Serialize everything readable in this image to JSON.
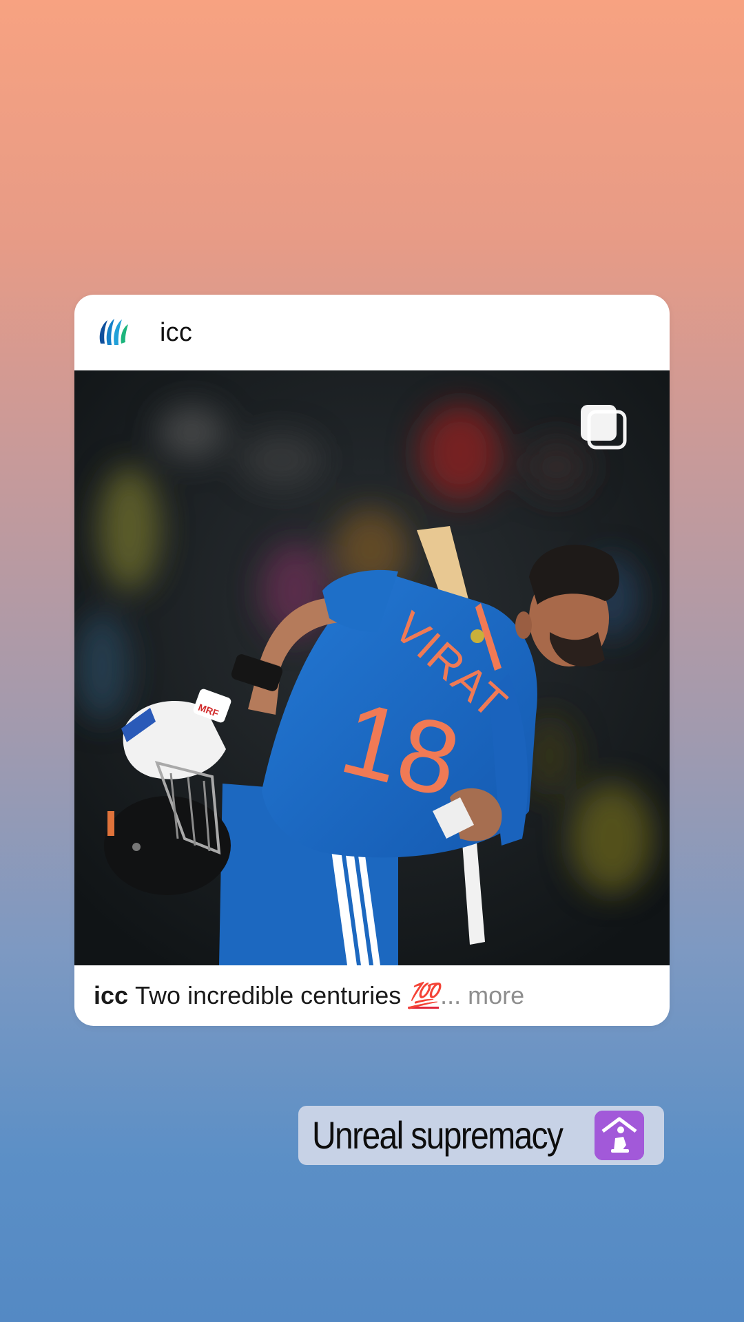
{
  "post": {
    "username": "icc",
    "avatar_icon": "icc-logo",
    "media_icon": "carousel-icon",
    "caption": {
      "user": "icc",
      "text": "Two incredible centuries",
      "emoji": "💯",
      "more": "... more"
    },
    "jersey": {
      "name": "VIRAT",
      "number": "18"
    },
    "bat_logo": "MRF"
  },
  "sticker": {
    "text": "Unreal supremacy",
    "emoji": "🛐"
  },
  "colors": {
    "gradient_top": "#f7a281",
    "gradient_bottom": "#5489c4",
    "jersey_blue": "#1e6fc8",
    "jersey_text": "#f07a55",
    "sticker_bg": "#c7d2e6",
    "emoji_purple": "#a259d9"
  }
}
